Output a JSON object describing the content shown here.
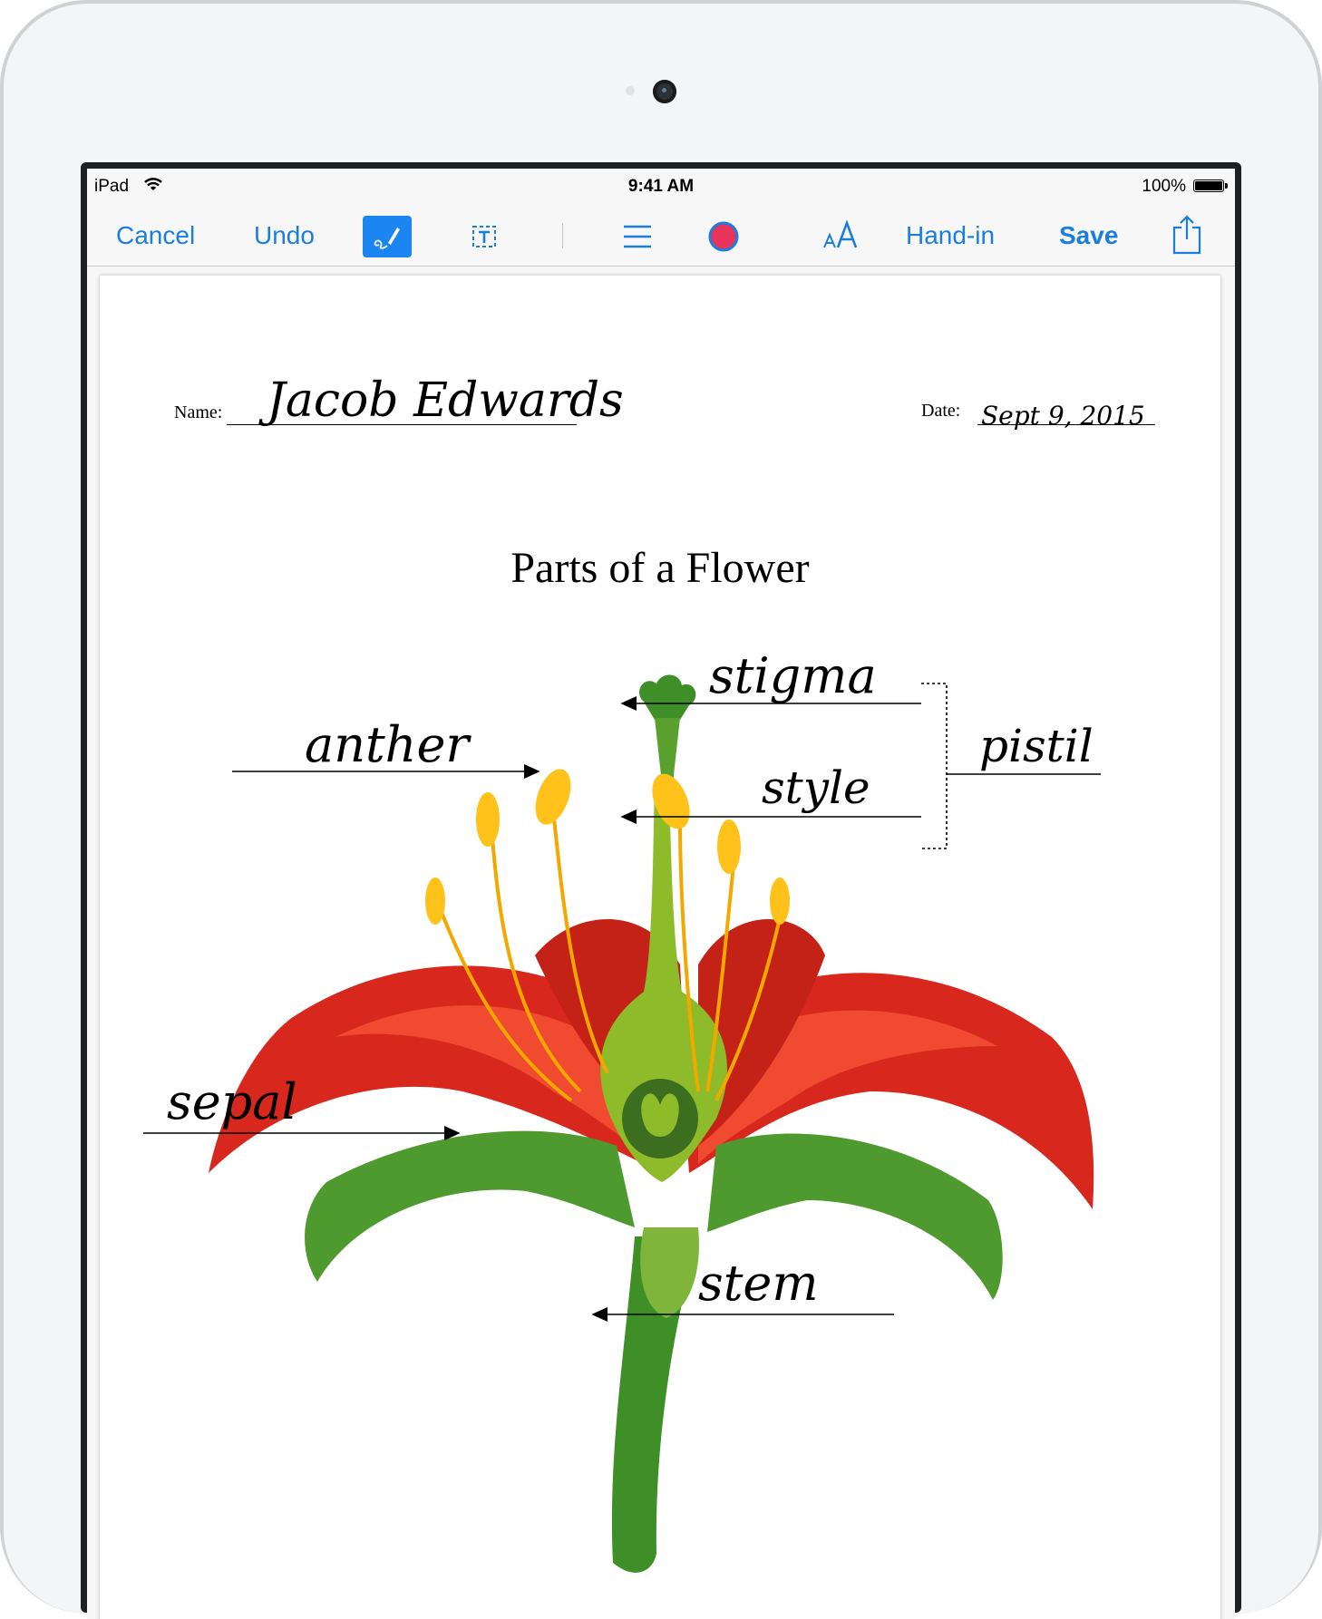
{
  "status_bar": {
    "carrier": "iPad",
    "time": "9:41 AM",
    "battery": "100%"
  },
  "toolbar": {
    "cancel": "Cancel",
    "undo": "Undo",
    "hand_in": "Hand-in",
    "save": "Save",
    "pen_color": "#e8345a",
    "accent": "#1a7ee0",
    "icons": [
      "pen-icon",
      "text-box-icon",
      "menu-icon",
      "color-picker-icon",
      "text-size-icon",
      "share-icon"
    ]
  },
  "worksheet": {
    "name_label": "Name:",
    "name_value": "Jacob Edwards",
    "date_label": "Date:",
    "date_value": "Sept 9, 2015",
    "title": "Parts of a Flower",
    "labels": {
      "stigma": "stigma",
      "anther": "anther",
      "style": "style",
      "pistil": "pistil",
      "sepal": "sepal",
      "stem": "stem"
    }
  }
}
